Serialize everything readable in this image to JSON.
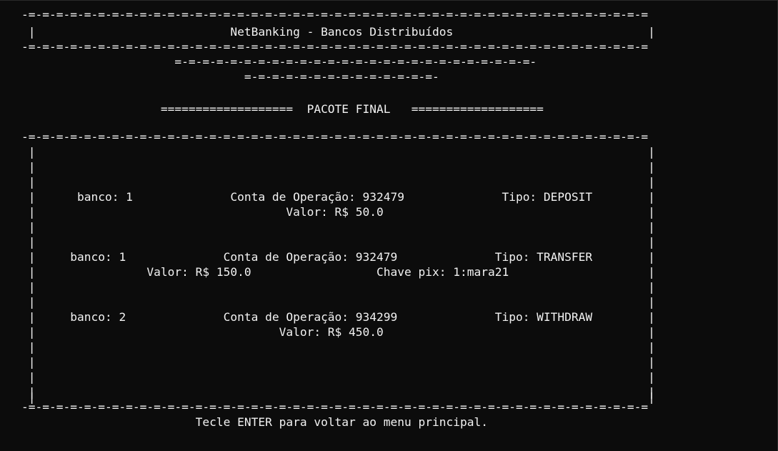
{
  "terminal": {
    "lines": [
      "-=-=-=-=-=-=-=-=-=-=-=-=-=-=-=-=-=-=-=-=-=-=-=-=-=-=-=-=-=-=-=-=-=-=-=-=-=-=-=-=-=-=-=-=-=",
      " |                            NetBanking - Bancos Distribuídos                            |",
      "-=-=-=-=-=-=-=-=-=-=-=-=-=-=-=-=-=-=-=-=-=-=-=-=-=-=-=-=-=-=-=-=-=-=-=-=-=-=-=-=-=-=-=-=-=",
      "                      =-=-=-=-=-=-=-=-=-=-=-=-=-=-=-=-=-=-=-=-=-=-=-=-=-=-",
      "                                =-=-=-=-=-=-=-=-=-=-=-=-=-=-",
      "",
      "                    ===================  PACOTE FINAL   ===================",
      "",
      "-=-=-=-=-=-=-=-=-=-=-=-=-=-=-=-=-=-=-=-=-=-=-=-=-=-=-=-=-=-=-=-=-=-=-=-=-=-=-=-=-=-=-=-=-=",
      " |                                                                                        |",
      " |                                                                                        |",
      " |                                                                                        |",
      " |      banco: 1              Conta de Operação: 932479              Tipo: DEPOSIT        |",
      " |                                    Valor: R$ 50.0                                      |",
      " |                                                                                        |",
      " |                                                                                        |",
      " |     banco: 1              Conta de Operação: 932479              Tipo: TRANSFER        |",
      " |                Valor: R$ 150.0                  Chave pix: 1:mara21                    |",
      " |                                                                                        |",
      " |                                                                                        |",
      " |     banco: 2              Conta de Operação: 934299              Tipo: WITHDRAW        |",
      " |                                   Valor: R$ 450.0                                      |",
      " |                                                                                        |",
      " |                                                                                        |",
      " |                                                                                        |",
      " |                                                                                        |",
      " |                                                                                        |",
      "-=-=-=-=-=-=-=-=-=-=-=-=-=-=-=-=-=-=-=-=-=-=-=-=-=-=-=-=-=-=-=-=-=-=-=-=-=-=-=-=-=-=-=-=-=",
      "                         Tecle ENTER para voltar ao menu principal."
    ]
  }
}
